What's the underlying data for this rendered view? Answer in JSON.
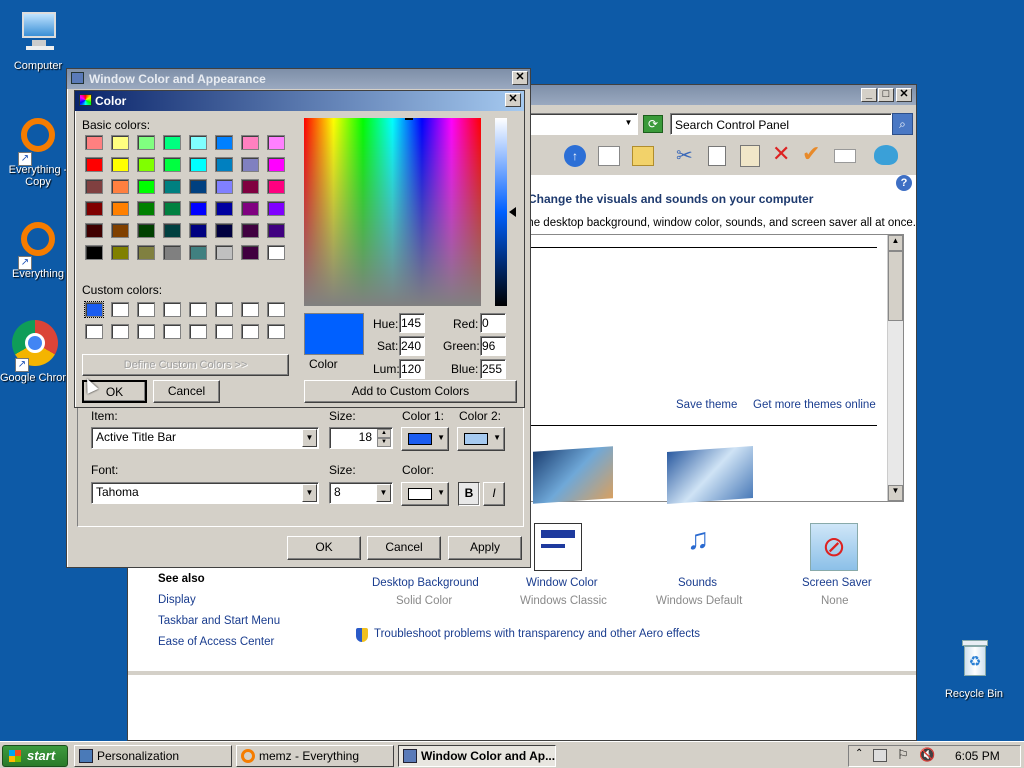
{
  "desktop": {
    "icons": [
      {
        "label": "Computer"
      },
      {
        "label": "Everything - Copy"
      },
      {
        "label": "Everything"
      },
      {
        "label": "Google Chrome"
      },
      {
        "label": "Recycle Bin"
      }
    ]
  },
  "personalization": {
    "search_placeholder": "Search Control Panel",
    "heading": "Change the visuals and sounds on your computer",
    "description": "Click a theme to change the desktop background, window color, sounds, and screen saver all at once.",
    "save_theme": "Save theme",
    "get_more_themes": "Get more themes online",
    "see_also_title": "See also",
    "see_also": [
      "Display",
      "Taskbar and Start Menu",
      "Ease of Access Center"
    ],
    "settings": [
      {
        "title": "Desktop Background",
        "value": "Solid Color"
      },
      {
        "title": "Window Color",
        "value": "Windows Classic"
      },
      {
        "title": "Sounds",
        "value": "Windows Default"
      },
      {
        "title": "Screen Saver",
        "value": "None"
      }
    ],
    "troubleshoot": "Troubleshoot problems with transparency and other Aero effects"
  },
  "appearance": {
    "title": "Window Color and Appearance",
    "item_label": "Item:",
    "item_value": "Active Title Bar",
    "size_label": "Size:",
    "size_value": "18",
    "color1_label": "Color 1:",
    "color2_label": "Color 2:",
    "color1": "#1a5cf0",
    "color2": "#a6caf0",
    "font_label": "Font:",
    "font_value": "Tahoma",
    "font_size_label": "Size:",
    "font_size_value": "8",
    "font_color_label": "Color:",
    "bold": "B",
    "italic": "I",
    "ok": "OK",
    "cancel": "Cancel",
    "apply": "Apply"
  },
  "color_dialog": {
    "title": "Color",
    "basic_colors_label": "Basic colors:",
    "basic_colors": [
      "#ff8080",
      "#ffff80",
      "#80ff80",
      "#00ff80",
      "#80ffff",
      "#0080ff",
      "#ff80c0",
      "#ff80ff",
      "#ff0000",
      "#ffff00",
      "#80ff00",
      "#00ff40",
      "#00ffff",
      "#0080c0",
      "#8080c0",
      "#ff00ff",
      "#804040",
      "#ff8040",
      "#00ff00",
      "#008080",
      "#004080",
      "#8080ff",
      "#800040",
      "#ff0080",
      "#800000",
      "#ff8000",
      "#008000",
      "#008040",
      "#0000ff",
      "#0000a0",
      "#800080",
      "#8000ff",
      "#400000",
      "#804000",
      "#004000",
      "#004040",
      "#000080",
      "#000040",
      "#400040",
      "#400080",
      "#000000",
      "#808000",
      "#808040",
      "#808080",
      "#408080",
      "#c0c0c0",
      "#400040",
      "#ffffff"
    ],
    "custom_colors_label": "Custom colors:",
    "custom_colors": [
      "#1a5cf0",
      "#ffffff",
      "#ffffff",
      "#ffffff",
      "#ffffff",
      "#ffffff",
      "#ffffff",
      "#ffffff",
      "#ffffff",
      "#ffffff",
      "#ffffff",
      "#ffffff",
      "#ffffff",
      "#ffffff",
      "#ffffff",
      "#ffffff"
    ],
    "define_custom": "Define Custom Colors >>",
    "ok": "OK",
    "cancel": "Cancel",
    "color_solid_label": "Color",
    "selected_color": "#0060ff",
    "hue_label": "Hue:",
    "hue": "145",
    "sat_label": "Sat:",
    "sat": "240",
    "lum_label": "Lum:",
    "lum": "120",
    "red_label": "Red:",
    "red": "0",
    "green_label": "Green:",
    "green": "96",
    "blue_label": "Blue:",
    "blue": "255",
    "add_custom": "Add to Custom Colors"
  },
  "taskbar": {
    "start": "start",
    "buttons": [
      {
        "label": "Personalization"
      },
      {
        "label": "memz - Everything"
      },
      {
        "label": "Window Color and Ap..."
      }
    ],
    "clock": "6:05 PM"
  }
}
